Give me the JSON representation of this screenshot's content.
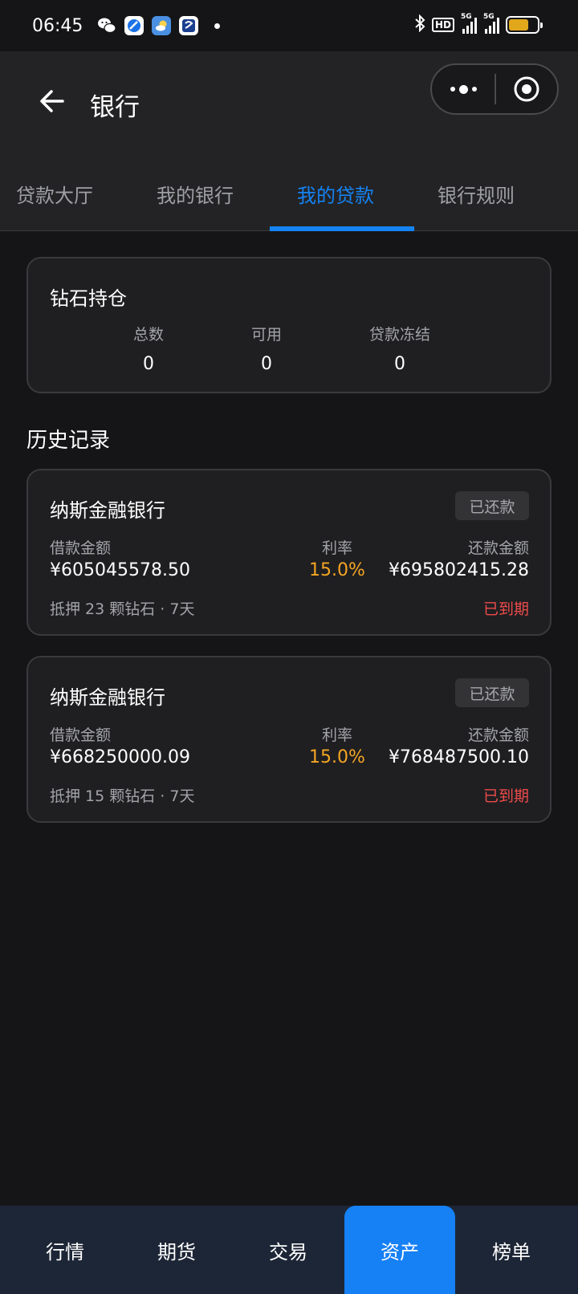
{
  "status_bar": {
    "time": "06:45",
    "hd": "HD",
    "network1": "5G",
    "network2": "5G",
    "battery_level": 0.7,
    "battery_color": "#e1a81c"
  },
  "header": {
    "title": "银行"
  },
  "tabs": [
    {
      "label": "贷款大厅"
    },
    {
      "label": "我的银行"
    },
    {
      "label": "我的贷款"
    },
    {
      "label": "银行规则"
    }
  ],
  "active_tab": "我的贷款",
  "holdings": {
    "title": "钻石持仓",
    "stats": [
      {
        "label": "总数",
        "value": "0"
      },
      {
        "label": "可用",
        "value": "0"
      },
      {
        "label": "贷款冻结",
        "value": "0"
      }
    ]
  },
  "history": {
    "title": "历史记录",
    "records": [
      {
        "bank": "纳斯金融银行",
        "status": "已还款",
        "loan_label": "借款金额",
        "loan_amount": "¥605045578.50",
        "rate_label": "利率",
        "rate": "15.0%",
        "repay_label": "还款金额",
        "repay_amount": "¥695802415.28",
        "note": "抵押 23 颗钻石 · 7天",
        "expiry": "已到期"
      },
      {
        "bank": "纳斯金融银行",
        "status": "已还款",
        "loan_label": "借款金额",
        "loan_amount": "¥668250000.09",
        "rate_label": "利率",
        "rate": "15.0%",
        "repay_label": "还款金额",
        "repay_amount": "¥768487500.10",
        "note": "抵押 15 颗钻石 · 7天",
        "expiry": "已到期"
      }
    ]
  },
  "bottom_nav": [
    {
      "label": "行情"
    },
    {
      "label": "期货"
    },
    {
      "label": "交易"
    },
    {
      "label": "资产"
    },
    {
      "label": "榜单"
    }
  ],
  "active_nav": "资产",
  "colors": {
    "accent": "#1583f2",
    "rate": "#f5a524",
    "expired": "#ef4b4b",
    "nav_active": "#1680f5"
  }
}
